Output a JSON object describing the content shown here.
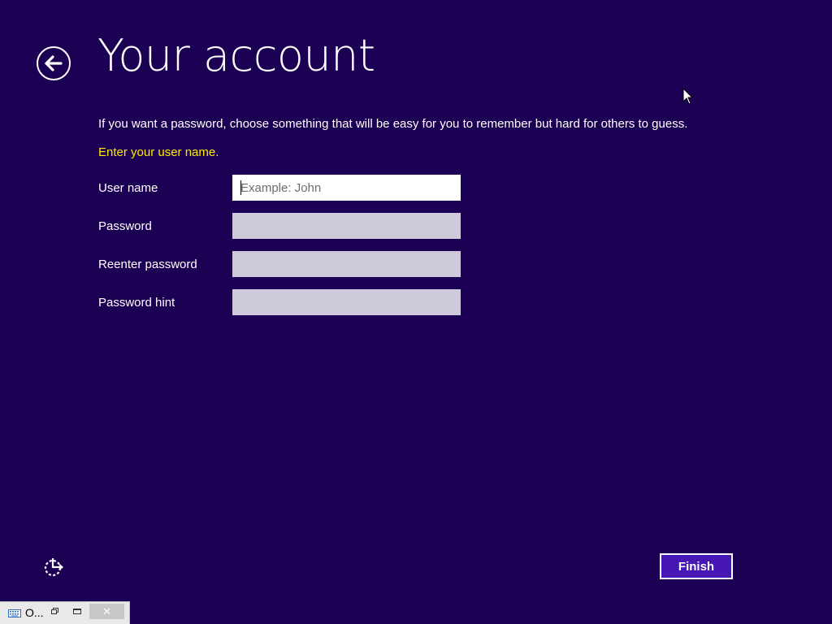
{
  "header": {
    "title": "Your account",
    "back_icon": "back-arrow-icon"
  },
  "instruction": "If you want a password, choose something that will be easy for you to remember but hard for others to guess.",
  "prompt": "Enter your user name.",
  "fields": [
    {
      "label": "User name",
      "placeholder": "Example: John",
      "value": ""
    },
    {
      "label": "Password",
      "placeholder": "",
      "value": ""
    },
    {
      "label": "Reenter password",
      "placeholder": "",
      "value": ""
    },
    {
      "label": "Password hint",
      "placeholder": "",
      "value": ""
    }
  ],
  "footer": {
    "ease_of_access_icon": "ease-of-access-icon",
    "finish_label": "Finish"
  },
  "taskbar": {
    "label": "O...",
    "keyboard_icon": "keyboard-icon",
    "restore_icon": "restore-icon",
    "minimize_icon": "minimize-icon",
    "close_icon": "close-icon",
    "close_glyph": "✕"
  },
  "colors": {
    "background": "#1b0053",
    "prompt_text": "#ffea00",
    "button_fill": "#4617b4",
    "inactive_field": "#cfc9dc"
  }
}
